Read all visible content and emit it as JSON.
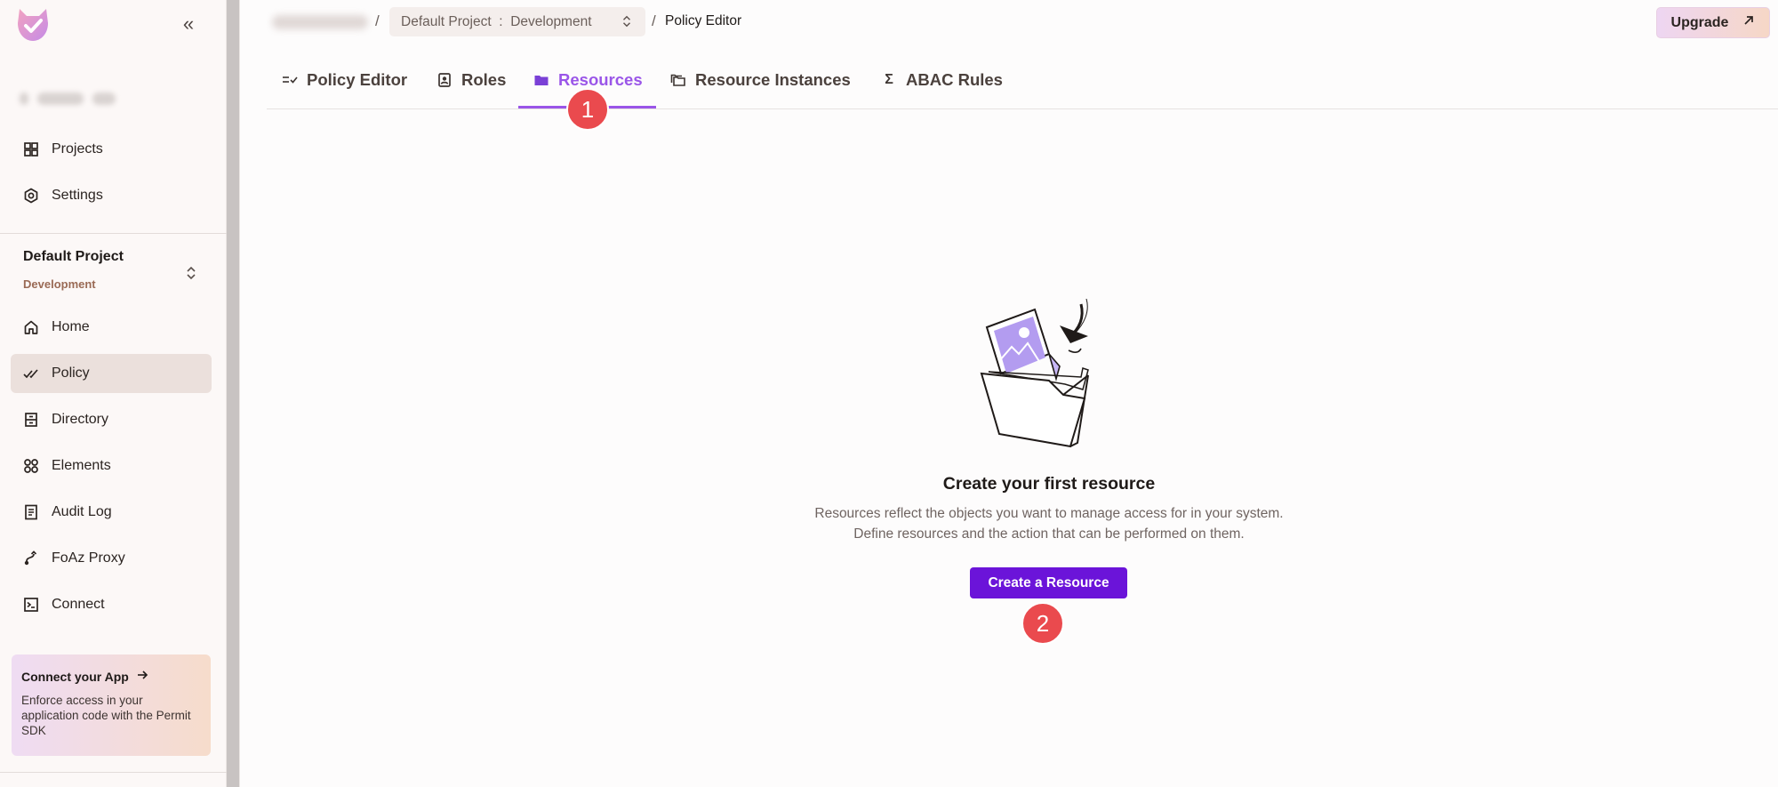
{
  "sidebar": {
    "logo_icon": "cat-check-logo-icon",
    "collapse_icon": "double-chevron-left-icon",
    "top_items": [
      {
        "label": "Projects",
        "icon": "grid-icon"
      },
      {
        "label": "Settings",
        "icon": "gear-icon"
      }
    ],
    "project": {
      "name": "Default Project",
      "environment": "Development"
    },
    "project_items": [
      {
        "label": "Home",
        "icon": "home-icon"
      },
      {
        "label": "Policy",
        "icon": "double-check-icon",
        "active": true
      },
      {
        "label": "Directory",
        "icon": "directory-icon"
      },
      {
        "label": "Elements",
        "icon": "elements-icon"
      },
      {
        "label": "Audit Log",
        "icon": "document-icon"
      },
      {
        "label": "FoAz Proxy",
        "icon": "proxy-icon"
      },
      {
        "label": "Connect",
        "icon": "terminal-icon"
      }
    ],
    "connect_card": {
      "title": "Connect your App",
      "description": "Enforce access in your application code with the Permit SDK"
    }
  },
  "topbar": {
    "separator": "/",
    "project_switch": "Default Project  :  Development",
    "current_page": "Policy Editor",
    "upgrade_label": "Upgrade"
  },
  "tabs": [
    {
      "label": "Policy Editor",
      "icon": "policy-editor-icon"
    },
    {
      "label": "Roles",
      "icon": "roles-icon"
    },
    {
      "label": "Resources",
      "icon": "folder-icon",
      "active": true
    },
    {
      "label": "Resource Instances",
      "icon": "instances-icon"
    },
    {
      "label": "ABAC Rules",
      "icon": "sigma-icon"
    }
  ],
  "empty_state": {
    "title": "Create your first resource",
    "description": "Resources reflect the objects you want to manage access for in your system. Define resources and the action that can be performed on them.",
    "button_label": "Create a Resource"
  },
  "annotations": [
    "1",
    "2"
  ],
  "colors": {
    "accent": "#9a55e8",
    "primary_button": "#6b14d9",
    "badge": "#ea4a4e",
    "sidebar_active": "#ebe0dc"
  }
}
